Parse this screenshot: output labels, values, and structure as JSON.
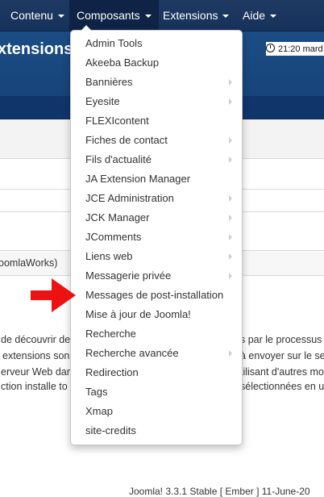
{
  "navbar": {
    "items": [
      {
        "label": "Contenu"
      },
      {
        "label": "Composants"
      },
      {
        "label": "Extensions"
      },
      {
        "label": "Aide"
      }
    ]
  },
  "header": {
    "title": "xtensions",
    "time": "21:20 mard"
  },
  "form": {
    "text": "oomlaWorks)"
  },
  "body_lines": [
    "de découvrir de",
    "s par le processus",
    "extensions son",
    "à envoyer sur le se",
    "erveur Web dan",
    "tilisant d'autres mo",
    "ction installe to",
    "sélectionnées en u"
  ],
  "footer": {
    "text": "Joomla! 3.3.1 Stable [ Ember ] 11-June-20"
  },
  "menu": {
    "items": [
      {
        "label": "Admin Tools",
        "submenu": false
      },
      {
        "label": "Akeeba Backup",
        "submenu": false
      },
      {
        "label": "Bannières",
        "submenu": true
      },
      {
        "label": "Eyesite",
        "submenu": true
      },
      {
        "label": "FLEXIcontent",
        "submenu": false
      },
      {
        "label": "Fiches de contact",
        "submenu": true
      },
      {
        "label": "Fils d'actualité",
        "submenu": true
      },
      {
        "label": "JA Extension Manager",
        "submenu": false
      },
      {
        "label": "JCE Administration",
        "submenu": true
      },
      {
        "label": "JCK Manager",
        "submenu": true
      },
      {
        "label": "JComments",
        "submenu": true
      },
      {
        "label": "Liens web",
        "submenu": true
      },
      {
        "label": "Messagerie privée",
        "submenu": true
      },
      {
        "label": "Messages de post-installation",
        "submenu": false
      },
      {
        "label": "Mise à jour de Joomla!",
        "submenu": false
      },
      {
        "label": "Recherche",
        "submenu": false
      },
      {
        "label": "Recherche avancée",
        "submenu": true
      },
      {
        "label": "Redirection",
        "submenu": false
      },
      {
        "label": "Tags",
        "submenu": false
      },
      {
        "label": "Xmap",
        "submenu": false
      },
      {
        "label": "site-credits",
        "submenu": false
      }
    ]
  },
  "colors": {
    "navbar": "#1f3a62",
    "header": "#1b4d85",
    "arrow": "#ee1111"
  },
  "icons": {
    "clock": "clock-icon",
    "submenu": "submenu-arrow-icon",
    "annotation": "red-arrow-icon"
  }
}
